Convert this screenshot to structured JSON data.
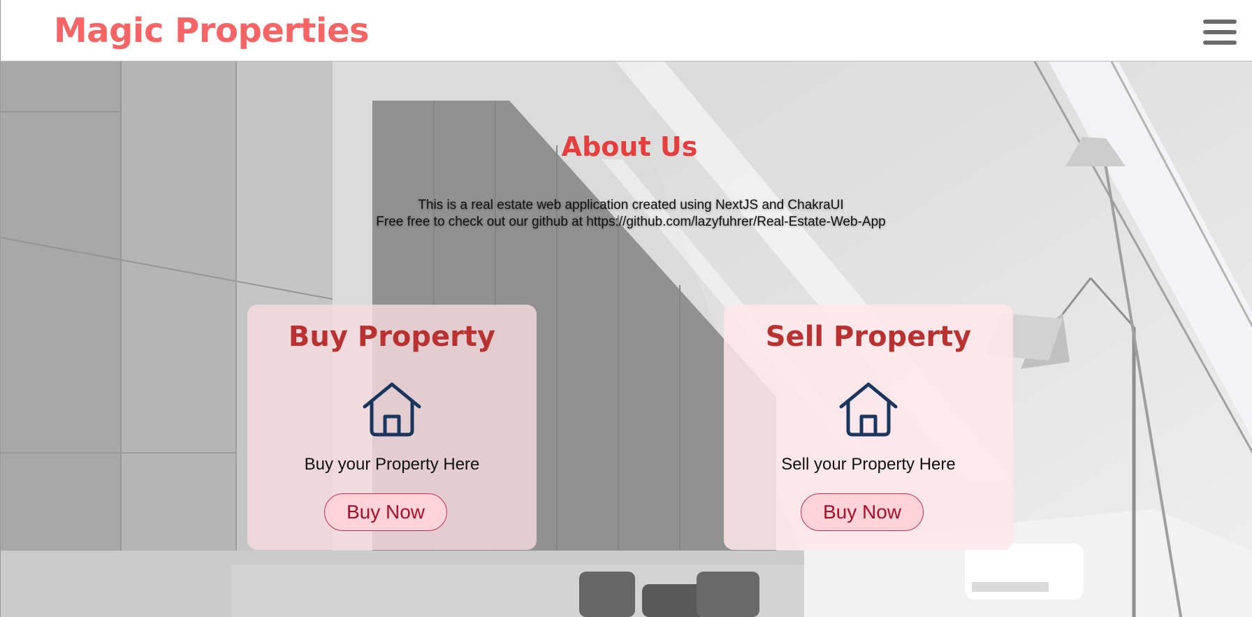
{
  "navbar": {
    "brand": "Magic Properties",
    "menu_icon": "hamburger-menu-icon"
  },
  "about": {
    "title": "About Us",
    "line1": "This is a real estate web application created using NextJS and ChakraUI",
    "line2": "Free free to check out our github at https://github.com/lazyfuhrer/Real-Estate-Web-App"
  },
  "cards": [
    {
      "title": "Buy Property",
      "icon": "house-icon",
      "description": "Buy your Property Here",
      "button_label": "Buy Now"
    },
    {
      "title": "Sell Property",
      "icon": "house-icon",
      "description": "Sell your Property Here",
      "button_label": "Buy Now"
    }
  ],
  "colors": {
    "brand": "#f56565",
    "heading": "#e53e3e",
    "card_title": "#b83232",
    "button_text": "#a3112d",
    "icon": "#1a365d"
  }
}
